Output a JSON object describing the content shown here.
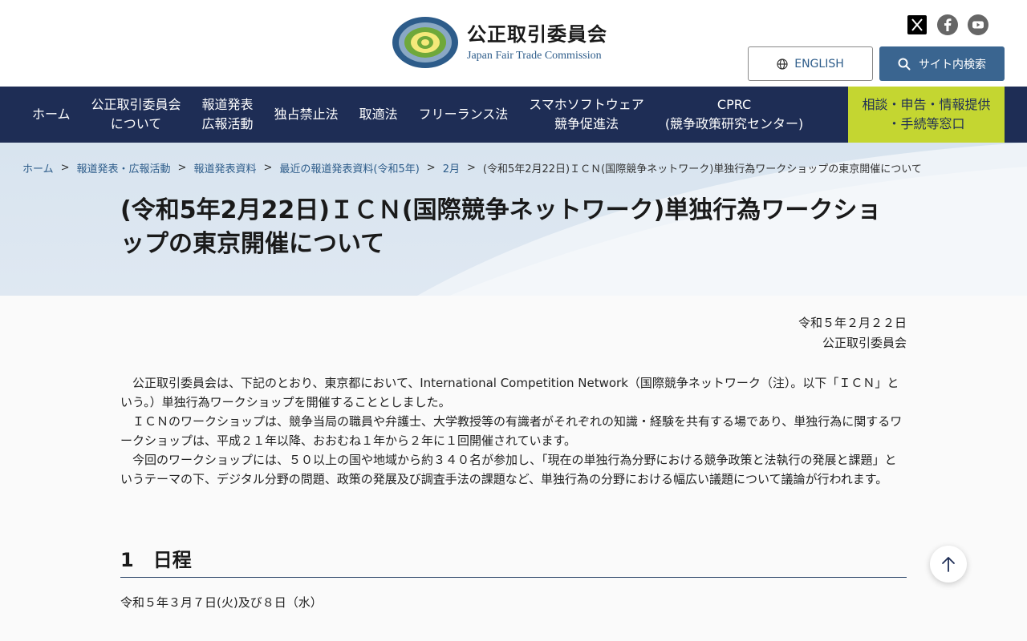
{
  "header": {
    "org_name_ja": "公正取引委員会",
    "org_name_en": "Japan Fair Trade Commission",
    "logo_ring_text": "JAPAN FAIR TRADE COMMISSION",
    "english_label": "ENGLISH",
    "search_label": "サイト内検索",
    "social_icons": [
      "x-icon",
      "facebook-icon",
      "youtube-icon"
    ]
  },
  "nav": {
    "items": [
      {
        "label": "ホーム"
      },
      {
        "label": "公正取引委員会\nについて"
      },
      {
        "label": "報道発表\n広報活動"
      },
      {
        "label": "独占禁止法"
      },
      {
        "label": "取適法"
      },
      {
        "label": "フリーランス法"
      },
      {
        "label": "スマホソフトウェア\n競争促進法"
      },
      {
        "label": "CPRC\n(競争政策研究センター)"
      }
    ],
    "consult_label": "相談・申告・情報提供\n・手続等窓口"
  },
  "breadcrumb": {
    "items": [
      "ホーム",
      "報道発表・広報活動",
      "報道発表資料",
      "最近の報道発表資料(令和5年)",
      "2月"
    ],
    "current": "(令和5年2月22日)ＩＣＮ(国際競争ネットワーク)単独行為ワークショップの東京開催について",
    "separator": ">"
  },
  "page": {
    "title": "(令和5年2月22日)ＩＣＮ(国際競争ネットワーク)単独行為ワークショップの東京開催について",
    "date": "令和５年２月２２日",
    "issuer": "公正取引委員会",
    "paragraphs": [
      "公正取引委員会は、下記のとおり、東京都において、International Competition Network（国際競争ネットワーク（注）。以下「ＩＣＮ」という。）単独行為ワークショップを開催することとしました。",
      "ＩＣＮのワークショップは、競争当局の職員や弁護士、大学教授等の有識者がそれぞれの知識・経験を共有する場であり、単独行為に関するワークショップは、平成２１年以降、おおむね１年から２年に１回開催されています。",
      "今回のワークショップには、５０以上の国や地域から約３４０名が参加し、「現在の単独行為分野における競争政策と法執行の発展と課題」というテーマの下、デジタル分野の問題、政策の発展及び調査手法の課題など、単独行為の分野における幅広い議題について議論が行われます。"
    ],
    "section_heading": "1　日程",
    "schedule": "令和５年３月７日(火)及び８日（水）"
  },
  "colors": {
    "nav_bg": "#1e2d55",
    "consult_bg": "#c4d631",
    "link": "#2d5c8a",
    "search_btn": "#3a6590"
  }
}
